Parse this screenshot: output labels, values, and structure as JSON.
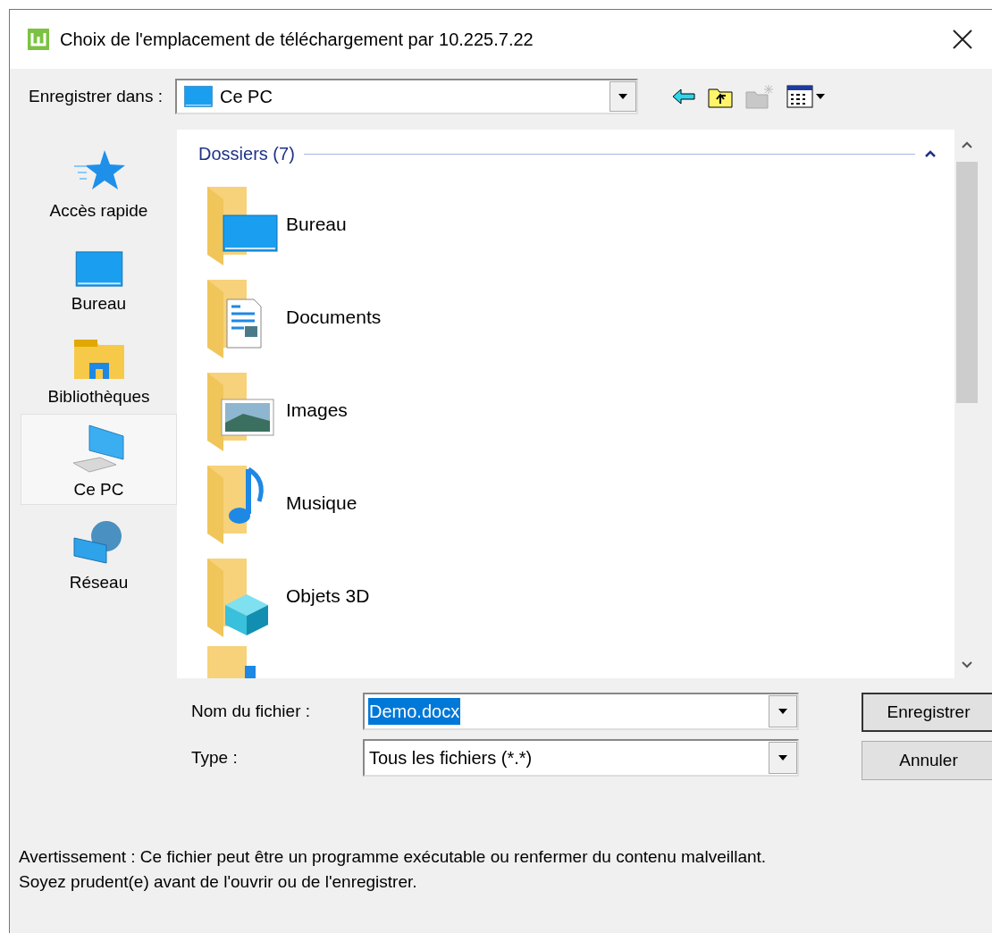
{
  "window": {
    "title": "Choix de l'emplacement de téléchargement par 10.225.7.22"
  },
  "location": {
    "label": "Enregistrer dans :",
    "value": "Ce PC"
  },
  "sidebar": {
    "items": [
      {
        "label": "Accès rapide",
        "selected": false
      },
      {
        "label": "Bureau",
        "selected": false
      },
      {
        "label": "Bibliothèques",
        "selected": false
      },
      {
        "label": "Ce PC",
        "selected": true
      },
      {
        "label": "Réseau",
        "selected": false
      }
    ]
  },
  "group": {
    "title": "Dossiers (7)",
    "expanded": true,
    "items": [
      {
        "name": "Bureau"
      },
      {
        "name": "Documents"
      },
      {
        "name": "Images"
      },
      {
        "name": "Musique"
      },
      {
        "name": "Objets 3D"
      }
    ]
  },
  "filename": {
    "label": "Nom du fichier :",
    "value": "Demo.docx",
    "text_selected": true
  },
  "type": {
    "label": "Type :",
    "value": "Tous les fichiers (*.*)"
  },
  "buttons": [
    "Enregistrer",
    "Annuler"
  ],
  "warning": "Avertissement : Ce fichier peut être un programme exécutable ou renfermer du contenu malveillant. Soyez prudent(e) avant de l'ouvrir ou de l'enregistrer."
}
